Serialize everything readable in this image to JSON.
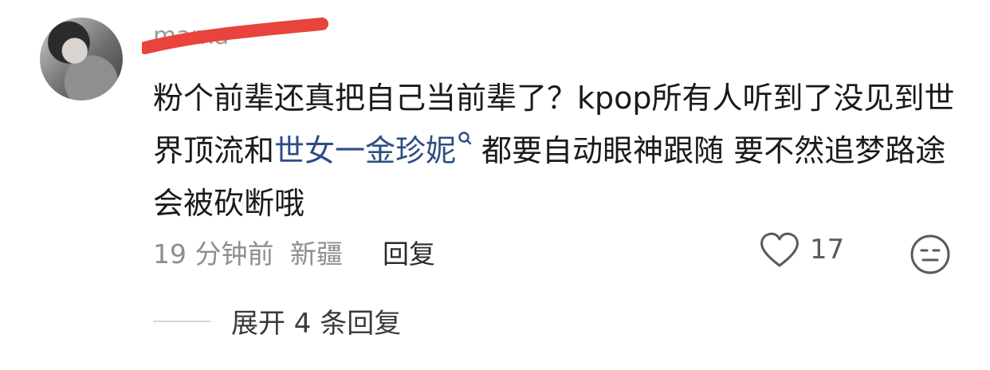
{
  "comment": {
    "username": "mama",
    "text_before": "粉个前辈还真把自己当前辈了？kpop所有人听到了没见到世界顶流和",
    "mention": "世女一金珍妮",
    "text_after": "都要自动眼神跟随 要不然追梦路途会被砍断哦",
    "time": "19 分钟前",
    "location": "新疆",
    "reply_label": "回复",
    "like_count": "17",
    "expand_label": "展开 4 条回复"
  },
  "colors": {
    "mention": "#2d4d83",
    "redaction": "#e8433c",
    "meta": "#8e8e8e"
  },
  "icons": {
    "like": "heart-icon",
    "face": "face-icon",
    "search_mini": "search-icon"
  }
}
